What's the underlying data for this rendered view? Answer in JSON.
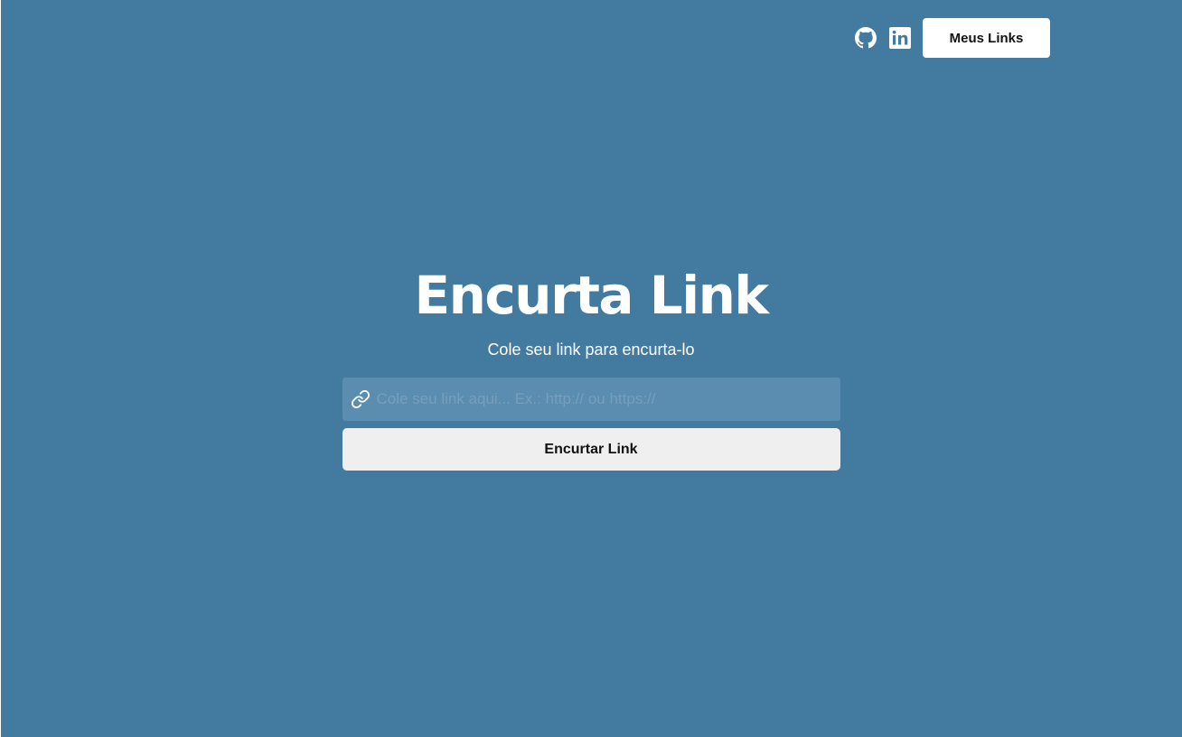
{
  "header": {
    "github_icon": "github-icon",
    "linkedin_icon": "linkedin-icon",
    "meus_links_label": "Meus Links"
  },
  "main": {
    "title": "Encurta Link",
    "subtitle": "Cole seu link para encurta-lo",
    "input": {
      "icon": "link-icon",
      "value": "",
      "placeholder": "Cole seu link aqui... Ex.: http:// ou https://"
    },
    "submit_label": "Encurtar Link"
  },
  "colors": {
    "background": "#437aa0",
    "input_background": "#5a8db0",
    "button_background": "#efefef",
    "primary_text": "#ffffff",
    "button_text": "#121212"
  }
}
